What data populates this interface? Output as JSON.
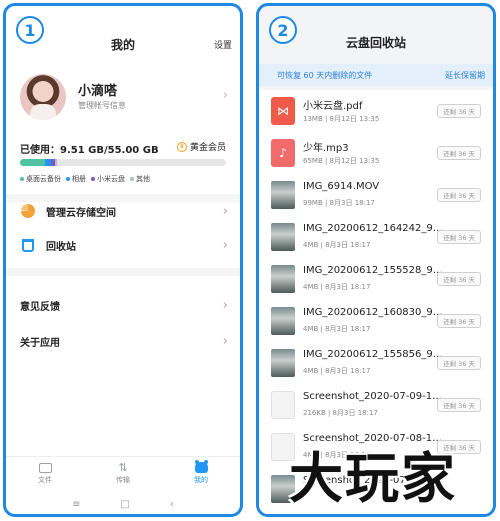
{
  "left": {
    "step": "1",
    "title": "我的",
    "settings_label": "设置",
    "profile": {
      "name": "小滴嗒",
      "subtitle": "管理帐号信息"
    },
    "storage": {
      "used_text": "已使用：9.51 GB/55.00 GB",
      "vip_label": "黄金会员",
      "segments": [
        {
          "label": "桌面云备份",
          "color": "#4fc3a1",
          "fraction": 0.12
        },
        {
          "label": "相册",
          "color": "#2196f3",
          "fraction": 0.03
        },
        {
          "label": "小米云盘",
          "color": "#7e57c2",
          "fraction": 0.02
        },
        {
          "label": "其他",
          "color": "#b0bec5",
          "fraction": 0.01
        }
      ]
    },
    "menu": [
      {
        "label": "管理云存储空间",
        "icon": "pie-chart-icon"
      },
      {
        "label": "回收站",
        "icon": "trash-bin-icon"
      },
      {
        "label": "意见反馈"
      },
      {
        "label": "关于应用"
      }
    ],
    "nav": [
      {
        "label": "文件",
        "icon": "folder-icon",
        "active": false
      },
      {
        "label": "传输",
        "icon": "transfer-icon",
        "active": false
      },
      {
        "label": "我的",
        "icon": "profile-icon",
        "active": true
      }
    ],
    "system_nav": [
      "≡",
      "□",
      "‹"
    ]
  },
  "right": {
    "step": "2",
    "title": "云盘回收站",
    "banner_text": "可恢复 60 天内删除的文件",
    "banner_action": "延长保留期",
    "files": [
      {
        "name": "小米云盘.pdf",
        "meta": "13MB | 8月12日 13:35",
        "keep": "还剩 36 天",
        "type": "pdf"
      },
      {
        "name": "少年.mp3",
        "meta": "65MB | 8月12日 13:35",
        "keep": "还剩 36 天",
        "type": "mp3"
      },
      {
        "name": "IMG_6914.MOV",
        "meta": "99MB | 8月3日 18:17",
        "keep": "还剩 36 天",
        "type": "photo"
      },
      {
        "name": "IMG_20200612_164242_9143...",
        "meta": "4MB | 8月3日 18:17",
        "keep": "还剩 36 天",
        "type": "photo"
      },
      {
        "name": "IMG_20200612_155528_9143...",
        "meta": "4MB | 8月3日 18:17",
        "keep": "还剩 36 天",
        "type": "photo"
      },
      {
        "name": "IMG_20200612_160830_9143...",
        "meta": "4MB | 8月3日 18:17",
        "keep": "还剩 36 天",
        "type": "photo"
      },
      {
        "name": "IMG_20200612_155856_9143...",
        "meta": "4MB | 8月3日 18:17",
        "keep": "还剩 36 天",
        "type": "photo"
      },
      {
        "name": "Screenshot_2020-07-09-15-15...",
        "meta": "216KB | 8月3日 18:17",
        "keep": "还剩 36 天",
        "type": "shot"
      },
      {
        "name": "Screenshot_2020-07-08-19-07...",
        "meta": "4MB | 8月3日 18:17",
        "keep": "还剩 36 天",
        "type": "shot"
      },
      {
        "name": "Screenshot_2020-07-08-19-07...",
        "meta": "",
        "keep": "",
        "type": "photo"
      }
    ]
  },
  "watermark": "大玩家"
}
